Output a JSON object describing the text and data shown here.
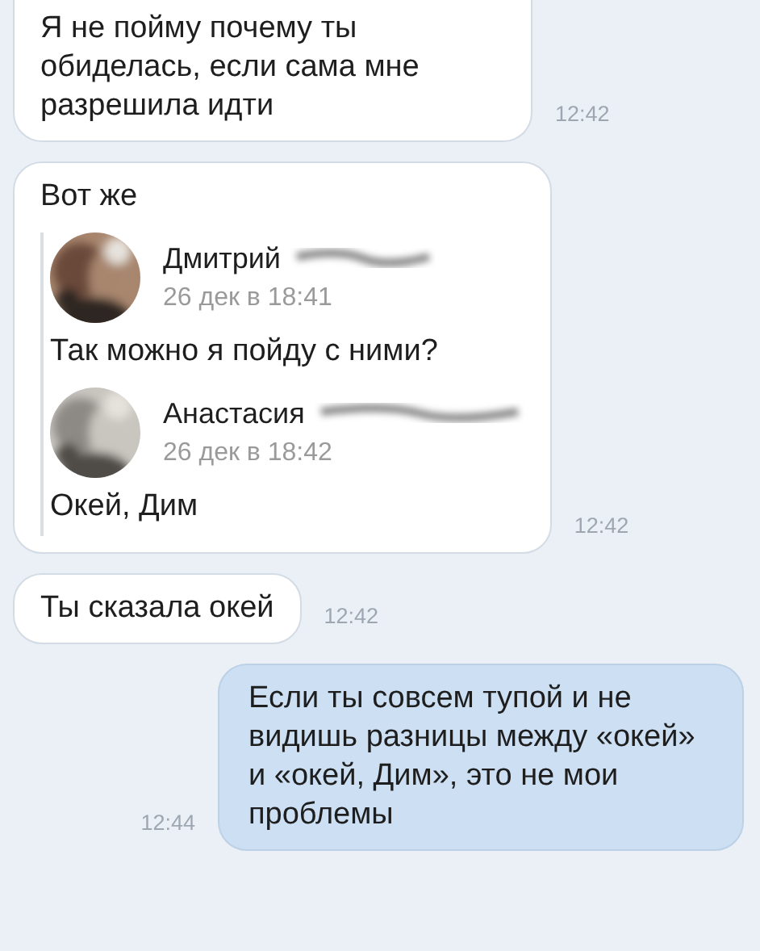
{
  "messages": [
    {
      "kind": "incoming",
      "text": "Я не пойму почему ты обиделась, если сама мне разрешила идти",
      "time": "12:42"
    },
    {
      "kind": "incoming",
      "text": "Вот же",
      "time": "12:42",
      "forwarded": [
        {
          "name": "Дмитрий",
          "date": "26 дек в 18:41",
          "text": "Так можно я пойду с ними?"
        },
        {
          "name": "Анастасия",
          "date": "26 дек в 18:42",
          "text": "Окей, Дим"
        }
      ]
    },
    {
      "kind": "incoming",
      "text": "Ты сказала окей",
      "time": "12:42"
    },
    {
      "kind": "outgoing",
      "text": "Если ты совсем тупой и не видишь разницы между «окей» и «окей, Дим», это не мои проблемы",
      "time": "12:44"
    }
  ]
}
